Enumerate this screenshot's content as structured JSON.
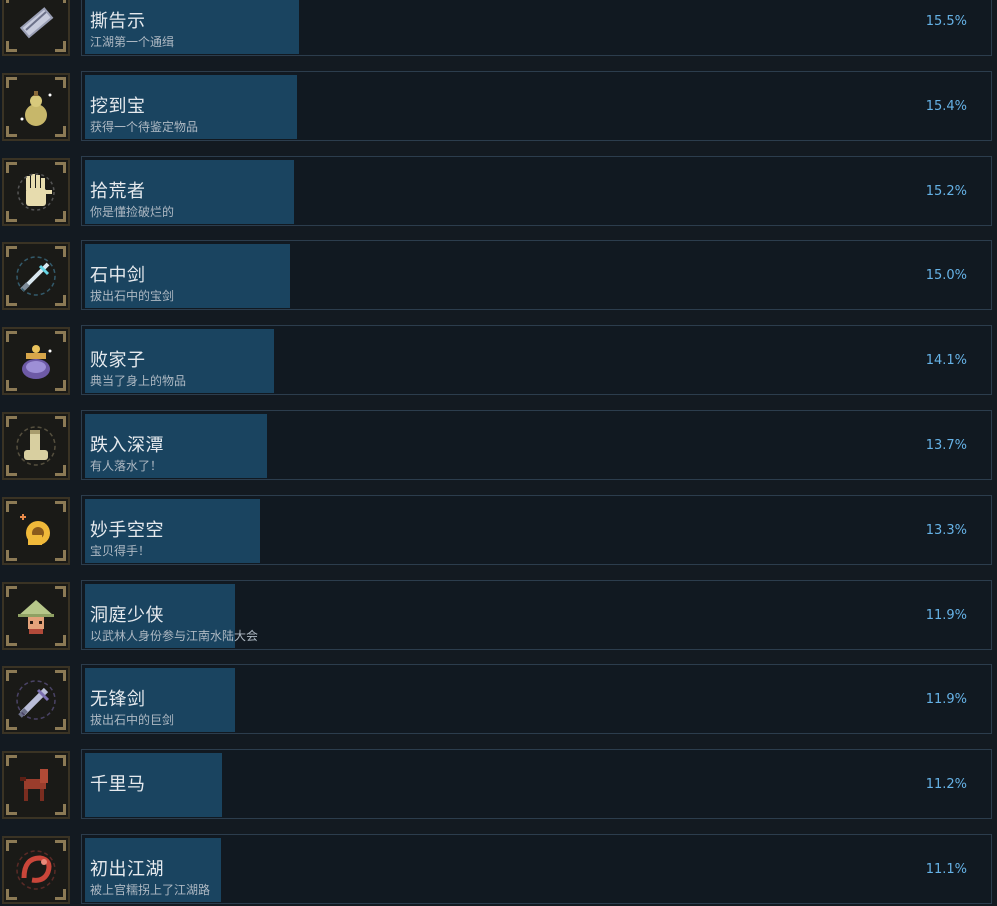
{
  "achievements": [
    {
      "title": "撕告示",
      "desc": "江湖第一个通缉",
      "pct_label": "15.5%",
      "pct": 15.5,
      "icon": "scroll-icon"
    },
    {
      "title": "挖到宝",
      "desc": "获得一个待鉴定物品",
      "pct_label": "15.4%",
      "pct": 15.4,
      "icon": "gourd-icon"
    },
    {
      "title": "拾荒者",
      "desc": "你是懂捡破烂的",
      "pct_label": "15.2%",
      "pct": 15.2,
      "icon": "hand-icon"
    },
    {
      "title": "石中剑",
      "desc": "拔出石中的宝剑",
      "pct_label": "15.0%",
      "pct": 15.0,
      "icon": "sword-icon"
    },
    {
      "title": "败家子",
      "desc": "典当了身上的物品",
      "pct_label": "14.1%",
      "pct": 14.1,
      "icon": "treasure-pot-icon"
    },
    {
      "title": "跌入深潭",
      "desc": "有人落水了！",
      "pct_label": "13.7%",
      "pct": 13.7,
      "icon": "boot-icon"
    },
    {
      "title": "妙手空空",
      "desc": "宝贝得手！",
      "pct_label": "13.3%",
      "pct": 13.3,
      "icon": "grabbing-hand-icon"
    },
    {
      "title": "洞庭少侠",
      "desc": "以武林人身份参与江南水陆大会",
      "pct_label": "11.9%",
      "pct": 11.9,
      "icon": "straw-hat-hero-icon"
    },
    {
      "title": "无锋剑",
      "desc": "拔出石中的巨剑",
      "pct_label": "11.9%",
      "pct": 11.9,
      "icon": "greatsword-icon"
    },
    {
      "title": "千里马",
      "desc": "",
      "pct_label": "11.2%",
      "pct": 11.2,
      "icon": "horse-icon"
    },
    {
      "title": "初出江湖",
      "desc": "被上官糯拐上了江湖路",
      "pct_label": "11.1%",
      "pct": 11.1,
      "icon": "dragon-icon"
    }
  ],
  "colors": {
    "background": "#131a21",
    "bar_fill": "#1a4460",
    "panel_border": "#2c3d4d",
    "percent_text": "#66b2e6",
    "title_text": "#e6eaee",
    "desc_text": "#aeb9c3"
  }
}
